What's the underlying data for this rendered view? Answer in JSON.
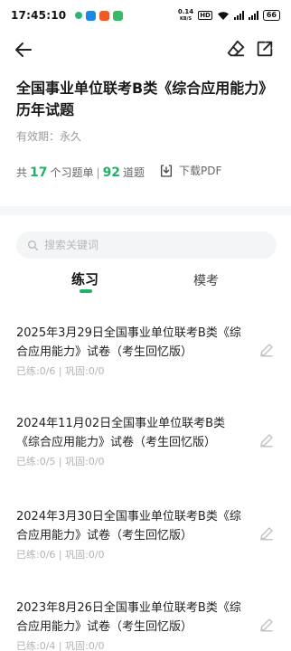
{
  "status_bar": {
    "time": "17:45:10",
    "net_speed_value": "0.14",
    "net_speed_unit": "KB/S",
    "hd": "HD",
    "battery": "66",
    "app_colors": [
      "#2bb673",
      "#1e88e5",
      "#f05a28",
      "#3db86b"
    ]
  },
  "header": {
    "title": "全国事业单位联考B类《综合应用能力》历年试题",
    "validity": "有效期：永久"
  },
  "stats": {
    "prefix": "共",
    "sets": "17",
    "sets_unit": "个习题单",
    "separator": "|",
    "questions": "92",
    "questions_unit": "道题",
    "download_label": "下载PDF"
  },
  "search": {
    "placeholder": "搜索关键词"
  },
  "tabs": [
    {
      "label": "练习",
      "active": true
    },
    {
      "label": "模考",
      "active": false
    }
  ],
  "papers": [
    {
      "title": "2025年3月29日全国事业单位联考B类《综合应用能力》试卷（考生回忆版）",
      "progress": "已练:0/6 | 巩固:0/0"
    },
    {
      "title": "2024年11月02日全国事业单位联考B类《综合应用能力》试卷（考生回忆版）",
      "progress": "已练:0/5 | 巩固:0/0"
    },
    {
      "title": "2024年3月30日全国事业单位联考B类《综合应用能力》试卷（考生回忆版）",
      "progress": "已练:0/6 | 巩固:0/0"
    },
    {
      "title": "2023年8月26日全国事业单位联考B类《综合应用能力》试卷（考生回忆版）",
      "progress": "已练:0/4 | 巩固:0/0"
    }
  ],
  "colors": {
    "accent": "#1fb26a",
    "muted_text": "#b3b3b3"
  }
}
